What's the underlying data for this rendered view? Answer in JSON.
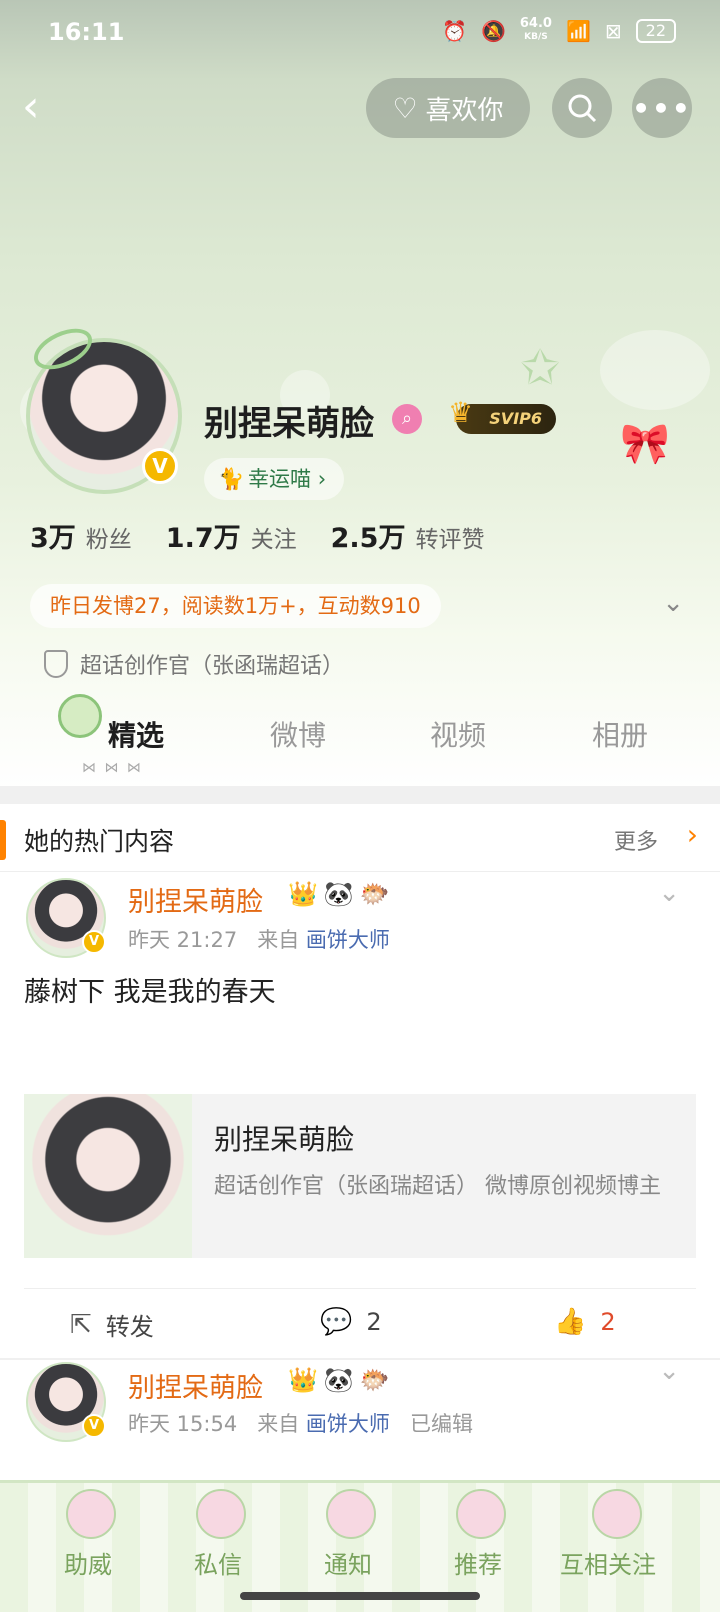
{
  "status_bar": {
    "time": "16:11",
    "net_speed_value": "64.0",
    "net_speed_unit": "KB/S",
    "battery": "22"
  },
  "top_nav": {
    "back_icon": "chevron-left-icon",
    "like_you_label": "喜欢你",
    "search_icon": "search-icon",
    "more_icon": "more-icon"
  },
  "profile": {
    "name": "别捏呆萌脸",
    "svip": "SVIP6",
    "lucky_tag": "幸运喵",
    "stats": [
      {
        "num": "3万",
        "label": "粉丝"
      },
      {
        "num": "1.7万",
        "label": "关注"
      },
      {
        "num": "2.5万",
        "label": "转评赞"
      }
    ],
    "daily_summary": "昨日发博27，阅读数1万+，互动数910",
    "super_topic": "超话创作官（张函瑞超话）"
  },
  "tabs": [
    "精选",
    "微博",
    "视频",
    "相册"
  ],
  "hot": {
    "title": "她的热门内容",
    "more": "更多"
  },
  "posts": [
    {
      "name": "别捏呆萌脸",
      "time": "昨天 21:27",
      "from": "来自",
      "source": "画饼大师",
      "text": "藤树下 我是我的春天",
      "card": {
        "title": "别捏呆萌脸",
        "desc": "超话创作官（张函瑞超话） 微博原创视频博主"
      },
      "actions": {
        "repost": "转发",
        "comments": "2",
        "likes": "2"
      }
    },
    {
      "name": "别捏呆萌脸",
      "time": "昨天 15:54",
      "from": "来自",
      "source": "画饼大师",
      "edited": "已编辑"
    }
  ],
  "bottom_nav": [
    "助威",
    "私信",
    "通知",
    "推荐",
    "互相关注"
  ],
  "colors": {
    "accent": "#ff8200",
    "name_orange": "#e36a14",
    "link_blue": "#4a6bb0",
    "theme_green": "#dde9d3"
  }
}
